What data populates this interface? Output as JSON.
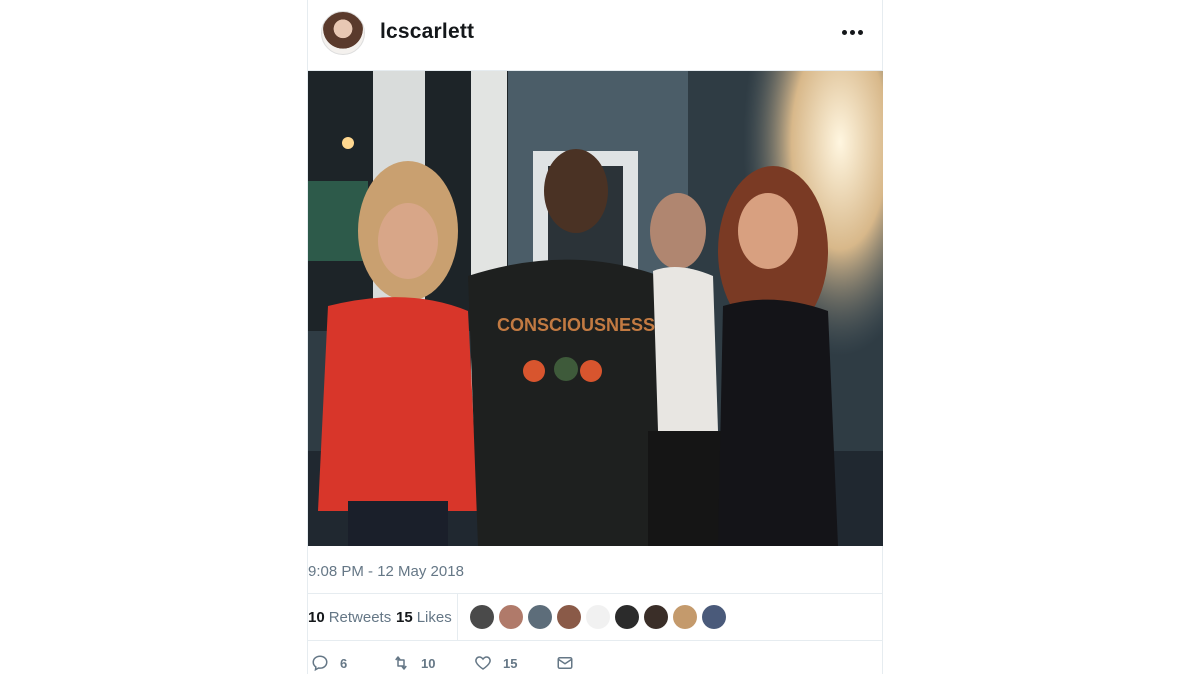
{
  "tweet": {
    "username": "lcscarlett",
    "timestamp": "9:08 PM - 12 May 2018",
    "stats": {
      "retweets_count": "10",
      "retweets_label": "Retweets",
      "likes_count": "15",
      "likes_label": "Likes"
    },
    "likers": [
      {
        "color": "#4a4a4a"
      },
      {
        "color": "#b07a6a"
      },
      {
        "color": "#5d6d7a"
      },
      {
        "color": "#8a5a48"
      },
      {
        "color": "#f1f1f1"
      },
      {
        "color": "#2b2b2b"
      },
      {
        "color": "#3a2e28"
      },
      {
        "color": "#c49a6c"
      },
      {
        "color": "#4a5a7a"
      }
    ],
    "actions": {
      "reply_count": "6",
      "retweet_count": "10",
      "like_count": "15"
    },
    "icons": {
      "more": "more-horizontal-icon",
      "reply": "reply-icon",
      "retweet": "retweet-icon",
      "like": "heart-icon",
      "message": "envelope-icon"
    }
  }
}
